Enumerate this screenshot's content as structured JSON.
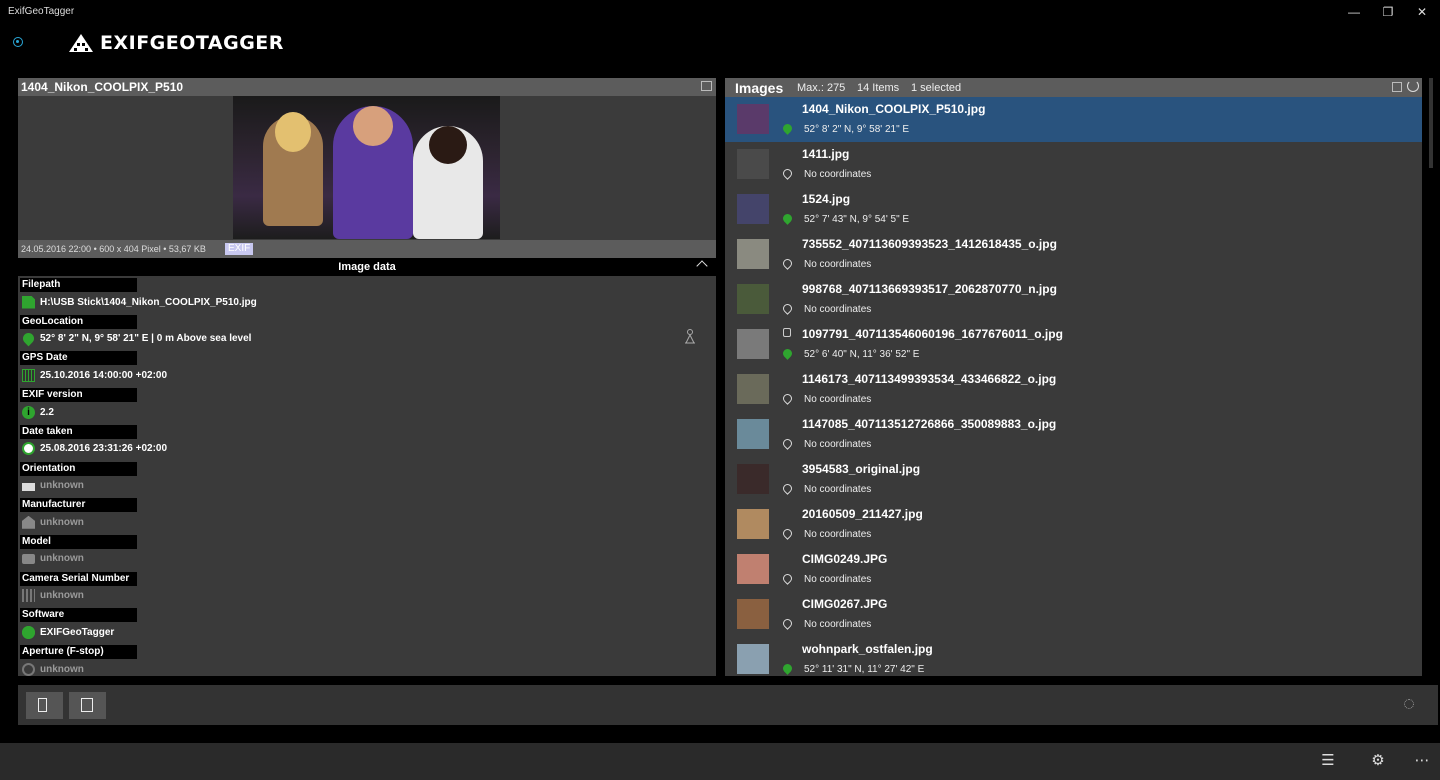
{
  "window": {
    "title": "ExifGeoTagger",
    "minimize_glyph": "—",
    "restore_glyph": "❐",
    "close_glyph": "✕"
  },
  "app": {
    "logo_text": "EXIFGEOTAGGER"
  },
  "preview": {
    "title": "1404_Nikon_COOLPIX_P510",
    "info": "24.05.2016 22:00 • 600 x 404 Pixel • 53,67 KB",
    "exif_badge": "EXIF"
  },
  "image_data": {
    "header": "Image data",
    "properties": [
      {
        "label": "Filepath",
        "value": "H:\\USB Stick\\1404_Nikon_COOLPIX_P510.jpg",
        "icon": "sd-card-icon",
        "muted": false
      },
      {
        "label": "GeoLocation",
        "value": "52° 8' 2\" N, 9° 58' 21\" E | 0 m Above sea level",
        "icon": "location-pin-icon",
        "muted": false
      },
      {
        "label": "GPS Date",
        "value": "25.10.2016 14:00:00 +02:00",
        "icon": "calendar-icon",
        "muted": false
      },
      {
        "label": "EXIF version",
        "value": "2.2",
        "icon": "info-icon",
        "muted": false
      },
      {
        "label": "Date taken",
        "value": "25.08.2016 23:31:26 +02:00",
        "icon": "clock-icon",
        "muted": false
      },
      {
        "label": "Orientation",
        "value": "unknown",
        "icon": "orientation-icon",
        "muted": true
      },
      {
        "label": "Manufacturer",
        "value": "unknown",
        "icon": "factory-icon",
        "muted": true
      },
      {
        "label": "Model",
        "value": "unknown",
        "icon": "camera-icon",
        "muted": true
      },
      {
        "label": "Camera Serial Number",
        "value": "unknown",
        "icon": "barcode-icon",
        "muted": true
      },
      {
        "label": "Software",
        "value": "EXIFGeoTagger",
        "icon": "gear-icon",
        "muted": false
      },
      {
        "label": "Aperture (F-stop)",
        "value": "unknown",
        "icon": "aperture-icon",
        "muted": true
      }
    ]
  },
  "images": {
    "title": "Images",
    "max": "Max.: 275",
    "count": "14 Items",
    "selected": "1 selected",
    "items": [
      {
        "name": "1404_Nikon_COOLPIX_P510.jpg",
        "coords": "52° 8' 2\" N, 9° 58' 21\" E",
        "has_coords": true,
        "selected": true,
        "locked": false,
        "thumb_color": "#5a3a6a"
      },
      {
        "name": "1411.jpg",
        "coords": "No coordinates",
        "has_coords": false,
        "selected": false,
        "locked": false,
        "thumb_color": "#4a4a4a"
      },
      {
        "name": "1524.jpg",
        "coords": "52° 7' 43\" N, 9° 54' 5\" E",
        "has_coords": true,
        "selected": false,
        "locked": false,
        "thumb_color": "#44446a"
      },
      {
        "name": "735552_407113609393523_1412618435_o.jpg",
        "coords": "No coordinates",
        "has_coords": false,
        "selected": false,
        "locked": false,
        "thumb_color": "#8a8a80"
      },
      {
        "name": "998768_407113669393517_2062870770_n.jpg",
        "coords": "No coordinates",
        "has_coords": false,
        "selected": false,
        "locked": false,
        "thumb_color": "#4a5a3a"
      },
      {
        "name": "1097791_407113546060196_1677676011_o.jpg",
        "coords": "52° 6' 40\" N, 11° 36' 52\" E",
        "has_coords": true,
        "selected": false,
        "locked": true,
        "thumb_color": "#7a7a7a"
      },
      {
        "name": "1146173_407113499393534_433466822_o.jpg",
        "coords": "No coordinates",
        "has_coords": false,
        "selected": false,
        "locked": false,
        "thumb_color": "#6a6a5a"
      },
      {
        "name": "1147085_407113512726866_350089883_o.jpg",
        "coords": "No coordinates",
        "has_coords": false,
        "selected": false,
        "locked": false,
        "thumb_color": "#6a8a9a"
      },
      {
        "name": "3954583_original.jpg",
        "coords": "No coordinates",
        "has_coords": false,
        "selected": false,
        "locked": false,
        "thumb_color": "#3a2a2a"
      },
      {
        "name": "20160509_211427.jpg",
        "coords": "No coordinates",
        "has_coords": false,
        "selected": false,
        "locked": false,
        "thumb_color": "#b08a60"
      },
      {
        "name": "CIMG0249.JPG",
        "coords": "No coordinates",
        "has_coords": false,
        "selected": false,
        "locked": false,
        "thumb_color": "#c08070"
      },
      {
        "name": "CIMG0267.JPG",
        "coords": "No coordinates",
        "has_coords": false,
        "selected": false,
        "locked": false,
        "thumb_color": "#8a6040"
      },
      {
        "name": "wohnpark_ostfalen.jpg",
        "coords": "52° 11' 31\" N, 11° 27' 42\" E",
        "has_coords": true,
        "selected": false,
        "locked": false,
        "thumb_color": "#8aa0b0"
      }
    ]
  },
  "appbar": {
    "list_glyph": "☰",
    "settings_glyph": "⚙",
    "more_glyph": "⋯"
  },
  "colors": {
    "accent_green": "#2fa52f",
    "selection_blue": "#29537e",
    "nav_accent": "#2aa8d8"
  }
}
